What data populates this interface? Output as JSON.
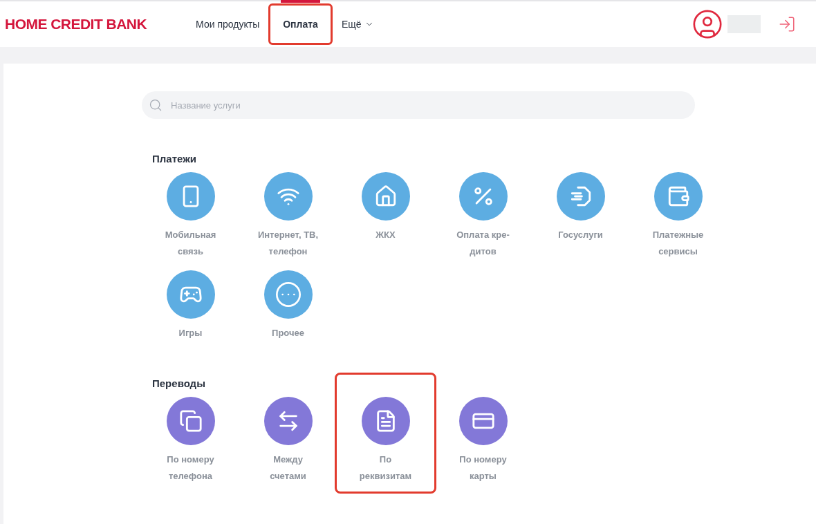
{
  "header": {
    "logo": "HOME CREDIT BANK",
    "nav": [
      {
        "label": "Мои продукты",
        "selected": false,
        "highlighted": false,
        "dropdown": false
      },
      {
        "label": "Оплата",
        "selected": true,
        "highlighted": true,
        "dropdown": false
      },
      {
        "label": "Ещё",
        "selected": false,
        "highlighted": false,
        "dropdown": true
      }
    ]
  },
  "search": {
    "placeholder": "Название услуги"
  },
  "sections": [
    {
      "title": "Платежи",
      "color": "#5dade2",
      "items": [
        {
          "lines": [
            "Мобильная",
            "связь"
          ],
          "highlighted": false
        },
        {
          "lines": [
            "Интернет, ТВ,",
            "телефон"
          ],
          "highlighted": false
        },
        {
          "lines": [
            "ЖКХ"
          ],
          "highlighted": false
        },
        {
          "lines": [
            "Оплата кре-",
            "дитов"
          ],
          "highlighted": false
        },
        {
          "lines": [
            "Госуслуги"
          ],
          "highlighted": false
        },
        {
          "lines": [
            "Платежные",
            "сервисы"
          ],
          "highlighted": false
        },
        {
          "lines": [
            "Игры"
          ],
          "highlighted": false
        },
        {
          "lines": [
            "Прочее"
          ],
          "highlighted": false
        }
      ]
    },
    {
      "title": "Переводы",
      "color": "#8378d8",
      "items": [
        {
          "lines": [
            "По номеру",
            "телефона"
          ],
          "highlighted": false
        },
        {
          "lines": [
            "Между",
            "счетами"
          ],
          "highlighted": false
        },
        {
          "lines": [
            "По",
            "реквизитам"
          ],
          "highlighted": true
        },
        {
          "lines": [
            "По номеру",
            "карты"
          ],
          "highlighted": false
        }
      ]
    }
  ]
}
